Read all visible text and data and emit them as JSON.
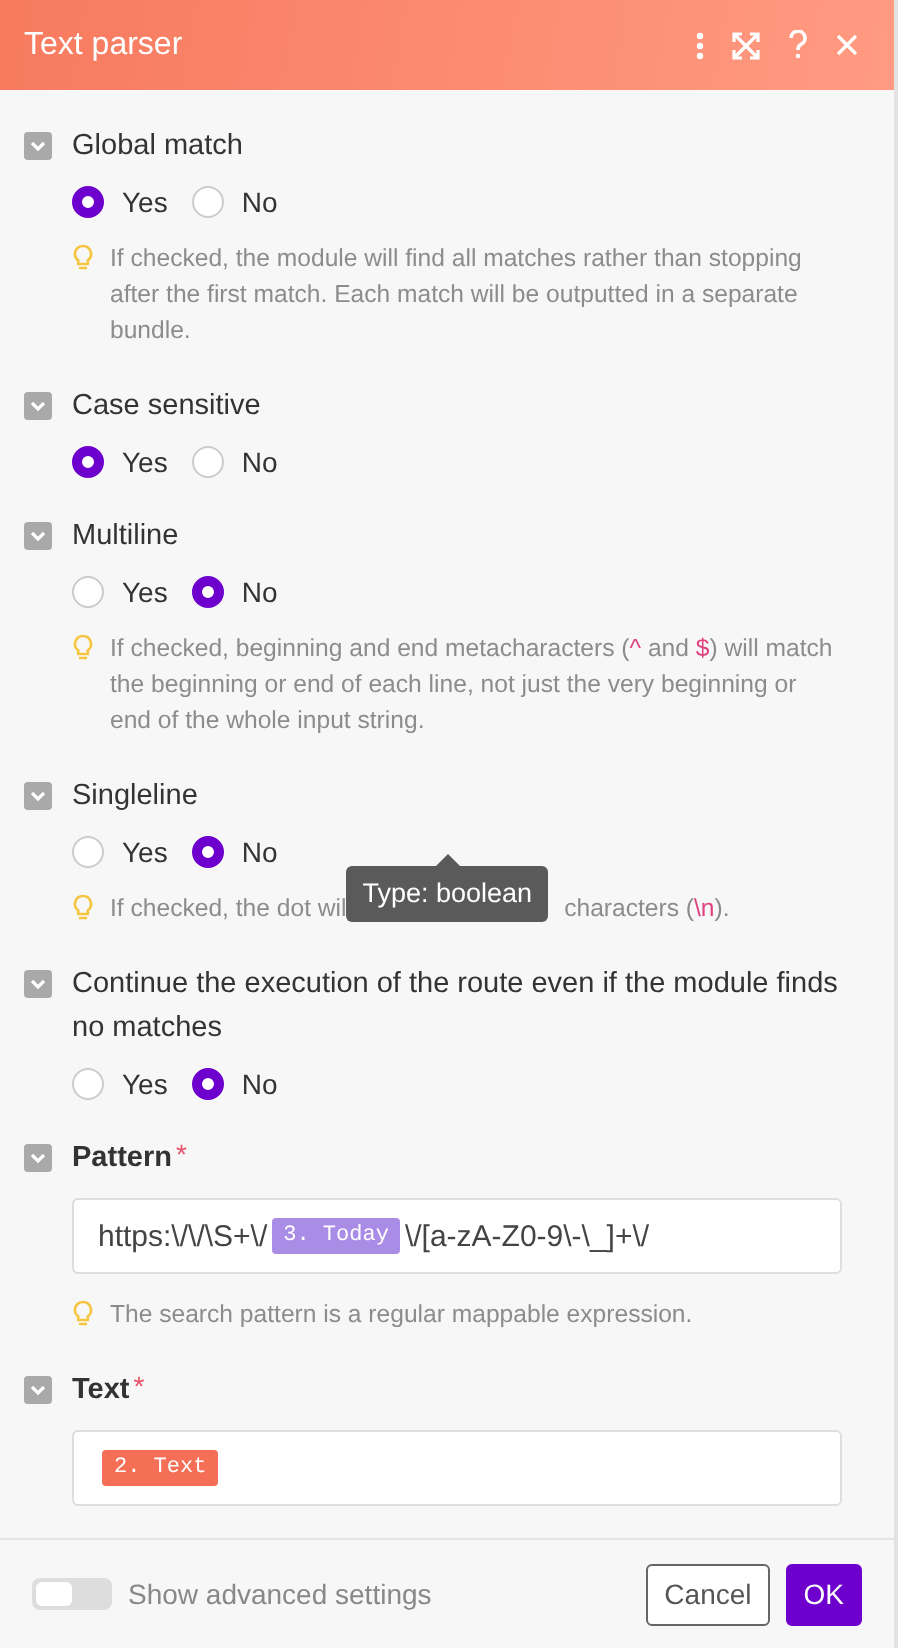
{
  "header": {
    "title": "Text parser"
  },
  "sections": [
    {
      "kind": "radio",
      "label": "Global match",
      "options": [
        {
          "label": "Yes",
          "selected": true
        },
        {
          "label": "No",
          "selected": false
        }
      ],
      "hint": [
        {
          "kind": "text",
          "text": "If checked, the module will find all matches rather than stopping after the first match. Each match will be outputted in a separate bundle."
        }
      ]
    },
    {
      "kind": "radio",
      "label": "Case sensitive",
      "options": [
        {
          "label": "Yes",
          "selected": true
        },
        {
          "label": "No",
          "selected": false
        }
      ]
    },
    {
      "kind": "radio",
      "label": "Multiline",
      "options": [
        {
          "label": "Yes",
          "selected": false
        },
        {
          "label": "No",
          "selected": true
        }
      ],
      "hint": [
        {
          "kind": "text",
          "text": "If checked, beginning and end metacharacters ("
        },
        {
          "kind": "code",
          "text": "^"
        },
        {
          "kind": "text",
          "text": " and "
        },
        {
          "kind": "code",
          "text": "$"
        },
        {
          "kind": "text",
          "text": ") will match the beginning or end of each line, not just the very beginning or end of the whole input string."
        }
      ]
    },
    {
      "kind": "radio",
      "label": "Singleline",
      "options": [
        {
          "label": "Yes",
          "selected": false
        },
        {
          "label": "No",
          "selected": true
        }
      ],
      "hint": [
        {
          "kind": "text",
          "text": "If checked, the dot wil"
        },
        {
          "kind": "tooltip",
          "text": "Type: boolean"
        },
        {
          "kind": "text",
          "text": "characters ("
        },
        {
          "kind": "code",
          "text": "\\n"
        },
        {
          "kind": "text",
          "text": ")."
        }
      ]
    },
    {
      "kind": "radio",
      "label": "Continue the execution of the route even if the module finds no matches",
      "options": [
        {
          "label": "Yes",
          "selected": false
        },
        {
          "label": "No",
          "selected": true
        }
      ]
    },
    {
      "kind": "field",
      "label": "Pattern",
      "required_mark": "*",
      "value": [
        {
          "kind": "text",
          "text": "https:\\/\\/\\S+\\/"
        },
        {
          "kind": "pill",
          "text": "3. Today",
          "color": "#a98ce6"
        },
        {
          "kind": "text",
          "text": "\\/[a-zA-Z0-9\\-\\_]+\\/"
        }
      ],
      "hint": [
        {
          "kind": "text",
          "text": "The search pattern is a regular mappable expression."
        }
      ]
    },
    {
      "kind": "field",
      "label": "Text",
      "required_mark": "*",
      "value": [
        {
          "kind": "pill",
          "text": "2. Text",
          "color": "#f46f55"
        }
      ]
    }
  ],
  "footer": {
    "advanced": {
      "label": "Show advanced settings",
      "on": false
    },
    "buttons": [
      {
        "label": "Cancel",
        "kind": "secondary"
      },
      {
        "label": "OK",
        "kind": "primary"
      }
    ]
  }
}
